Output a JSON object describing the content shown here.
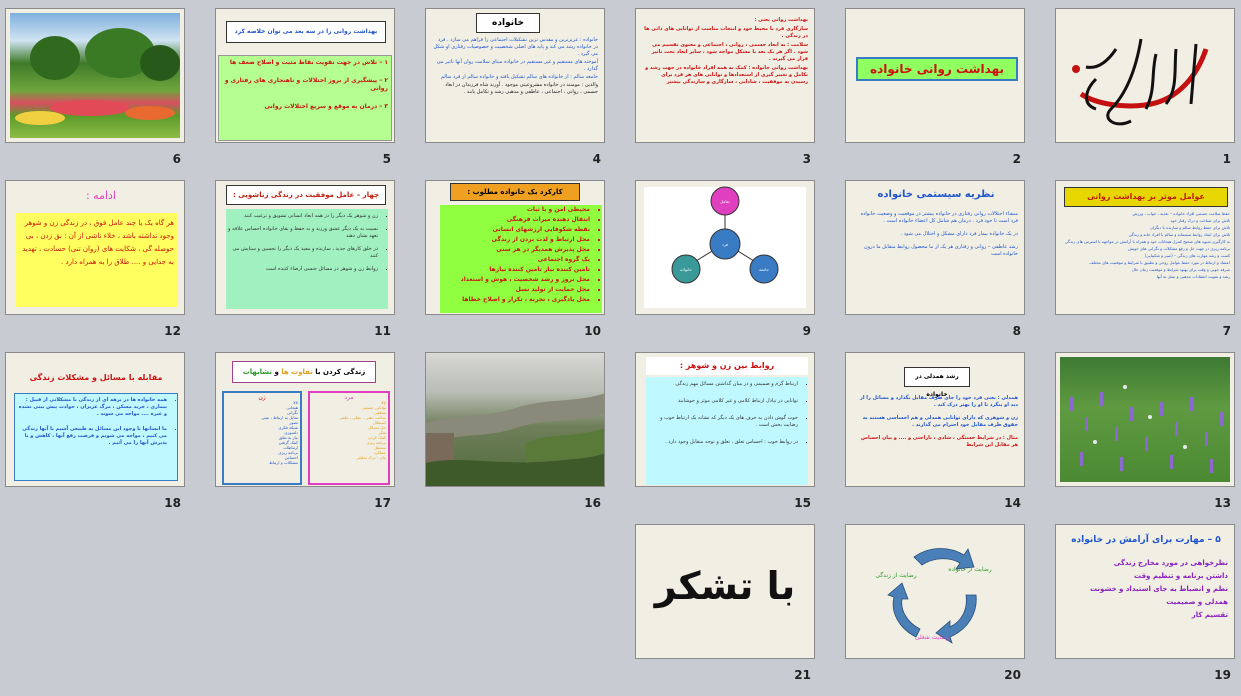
{
  "slides": [
    {
      "num": "1",
      "calligraphy": "بسم الله الرحمن الرحیم"
    },
    {
      "num": "2",
      "title": "بهداشت روانی خانواده"
    },
    {
      "num": "3",
      "lines": [
        "بهداشت روانی یعنی :",
        "سازگاری فرد با محیط خود و انتخاب مناسب از توانایی های ذاتی ها در زندگی .",
        "سلامت : به ابعاد جسمی ، روانی ، اجتماعی و معنوی تقسیم می شود . اگر هر یک بعد با مشکل مواجه شود ، سایر ابعاد تحت تاثیر قرار می گیرند .",
        "بهداشت روانی خانواده : کمک به همه افراد خانواده در جهت رشد و تکامل و تغییر گیری از استعدادها و توانایی های هر فرد برای رسیدن به موفقیت ، شادابی ، سازگاری و سازندگی بیشتر"
      ]
    },
    {
      "num": "4",
      "title": "خانواده",
      "lines": [
        "خانواده : عزیزترین و مقدس ترین تشکیلات اجتماعی را فراهم می سازد . فرد در خانواده رشد می کند و پایه های اصلی شخصیت و خصوصیات رفتاری او شکل می گیرد .",
        "آموخته های مستقیم و غیر مستقیم در خانواده مبنای سلامت روان آنها تاثیر می گذارد .",
        "جامعه سالم : از خانواده های سالم تشکیل یافته و خانواده سالم از فرد سالم",
        "والدین : مومنند در خانواده مشروعیتی موجود . آورند شاه فرزندان در ابعاد جسمی ، روانی ، اجتماعی ، عاطفی و مذهبی رشد و تکامل یابند ."
      ]
    },
    {
      "num": "5",
      "title": "بهداشت روانی را در سه بعد می توان خلاصه کرد",
      "lines": [
        "۱ – تلاش در جهت تقویت نقاط مثبت و اصلاح ضعف ها",
        "۲ – پیشگیری از بروز اختلالات و ناهنجاری های رفتاری و روانی",
        "۳ – درمان به موقع و سریع اختلالات روانی"
      ]
    },
    {
      "num": "6",
      "photo": "garden"
    },
    {
      "num": "7",
      "title": "عوامل موثر بر بهداشت روانی",
      "lines": [
        "حفظ سلامت جسمی افراد خانواده – تغذیه ، خواب ، ورزش",
        "تلاش برای شناخت و درک رفتار خود",
        "تلاش برای حفظ روابط سالم و سازنده با دیگران",
        "تلاش برای ایجاد روابط صمیمانه و سالم با افراد خانه و زندگی",
        "به کارگیری شیوه های صحیح کنترل هیجانات خود و همراه با آرامش در مواجهه با استرس های زندگی",
        "برنامه ریزی در جهت حل و رفع مشکلات و نگرانی های خویش",
        "کسب و رشد مهارت های زندگی – (صبر و شکیبایی)",
        "اعتماد و ارتباط در مورد حفظ عوامل روحی و تطبیق با شرایط و موقعیت های مختلف",
        "صرفه جویی و وقت برای بهبود شرایط و موقعیت زمان حال",
        "رشد و تقویت اعتقادات مذهبی و عمل به آنها"
      ]
    },
    {
      "num": "8",
      "title": "نظریه سیستمی خانواده",
      "lines": [
        "منشاء اختلالات روانی رفتاری در خانواده بیشتر در موقعیت و وضعیت خانواده فرد است تا خود فرد . درمان هم شامل کل اعضاء خانواده است .",
        "در یک خانواده بیمار فرد دارای مشکل و اختلال می شود .",
        "رشد عاطفی – روانی و رفتاری هر یک از ما محصول روابط متقابل ما درون خانواده است"
      ]
    },
    {
      "num": "9",
      "diagram": [
        "تعامل",
        "فرد",
        "خانواده",
        "جامعه"
      ]
    },
    {
      "num": "10",
      "title": "کارکرد یک خانواده مطلوب :",
      "lines": [
        "محیطی امن و با ثبات",
        "انتقال دهنده میراث فرهنگی",
        "نقطه شکوفایی ارزشهای انسانی",
        "محل ارتباط و لذت بردن از زندگی",
        "محل پذیرش همدیگر در هر سنی",
        "یک گروه اجتماعی",
        "تامین کننده نیاز تامین کننده نیازها",
        "محل بروز و رشد شخصیت ، هوش و استعداد",
        "محل حمایت از تولید نسل",
        "محل یادگیری ، تجربه ، تکرار و اصلاح خطاها"
      ]
    },
    {
      "num": "11",
      "title": "چهار – عامل موفقیت در زندگی زناشویی :",
      "lines": [
        "زن و شوهر یک دیگر را در همه ابعاد انسانی تشویق و ترغیب کنند",
        "نسبت به یک دیگر عشق ورزند و به حفظ و بقای خانواده احساس علاقه و تعهد نشان دهند",
        "در خلق کارهای جدید ، سازنده و مفید یک دیگر را تحسین و ستایش می کنند",
        "روابط زن و شوهر در مسائل جنسی ارضاء کننده است"
      ]
    },
    {
      "num": "12",
      "title": "ادامه :",
      "lines": [
        "هر گاه یک یا چند عامل فوق ، در زندگی زن و شوهر وجود نداشته باشد ، خلاء ناشی از آن : نق زدن ، بی حوصله گی ، شکایت های (روان تنی) حسادت ، تهدید به جدایی و .... طلاق را به همراه دارد ."
      ]
    },
    {
      "num": "13",
      "photo": "meadow"
    },
    {
      "num": "14",
      "title": "رشد همدلی در خانواده",
      "lines": [
        "همدلی : یعنی فرد خود را جای طرف مقابل بگذارد و مسائل را از دید او بنگرد تا او را بهتر درک کند .",
        "زن و شوهری که دارای توانایی همدلی و هم احساسی هستند به حقوق طرف مقابل خود احترام می گذارند .",
        "مثال : در شرایط خستگی ، شادی ، ناراحتی و .... و بیان احساس هر مقابل این شرایط"
      ]
    },
    {
      "num": "15",
      "title": "روابط بین زن و شوهر :",
      "lines": [
        "ارتباط گرم و صمیمی و در میان گذاشتن مسائل مهم زندگی",
        "توانایی در تبادل ارتباط کلامی و غیر کلامی موثر و خوشایند",
        "خوب گوش دادن به حرف های یک دیگر که نشانه یک ارتباط خوب و رضایت بخش است .",
        "در روابط خوب : احساس تعلق ، تعلق و توجه متقابل وجود دارد ."
      ]
    },
    {
      "num": "16",
      "photo": "great-wall"
    },
    {
      "num": "17",
      "title_a": "زندگی کردن با ",
      "title_b": "تفاوت ها",
      "title_c": " و ",
      "title_d": "تشابهات",
      "col_left_title": "زن",
      "col_left": [
        "xx",
        "هیجانی",
        "نگرانی",
        "تمایل به ارتباط ، عینی",
        "تصور",
        "شبکه فکری",
        "دلسوزی",
        "نیاز به تعلق",
        "کمک گرفتن",
        "ارتباطات",
        "برنامه ریزی",
        "احساس",
        "مشکلات و ارتباط"
      ],
      "col_right_title": "مرد",
      "col_right": [
        "xy",
        "توانایی جسمی",
        "منطقی",
        "ساخت ذهنی ، عقلی ، علمی",
        "استقلال",
        "حل مسائل",
        "تفکر",
        "کمک کردن",
        "برنامه ریزی",
        "مستقل",
        "عملکرد",
        "بیان - درک تحلیلی"
      ]
    },
    {
      "num": "18",
      "title": "مقابله با مسائل و مشکلات زندگی",
      "lines": [
        "همه خانواده ها در برهه ای از زندگی با مشکلاتی از قبیل : بیماری ، خرید مسکن ، مرگ عزیزان ، حوادث پیش بینی نشده و غیره .... مواجه می شوند .",
        "ما انسانها با وجود این مسائل به طبیعی آشیم با آنها زندگی می کنیم ، مواجه می شویم و فرصت رفع آنها ، کاهش و یا پذیرش آنها را می آئیم ."
      ]
    },
    {
      "num": "19",
      "title": "۵ – مهارت برای آرامش در خانواده",
      "lines": [
        "نظرخواهی در مورد مخارج زندگی",
        "داشتن برنامه و تنظیم وقت",
        "نظم و انضباط به جای استبداد و خشونت",
        "همدلی و صمیمیت",
        "تقسیم کار"
      ]
    },
    {
      "num": "20",
      "cycle": [
        "رضایت از خانواده",
        "رضایت شغلی",
        "رضایت از زندگی"
      ]
    },
    {
      "num": "21",
      "title": "با تشکر"
    }
  ],
  "colors": {
    "background": "#c8cbd1",
    "slide": "#f1efe4",
    "accent_green": "#90ff60",
    "accent_yellow": "#ffff7a",
    "accent_blue": "#3a7cc4",
    "accent_red": "#cc1111"
  }
}
